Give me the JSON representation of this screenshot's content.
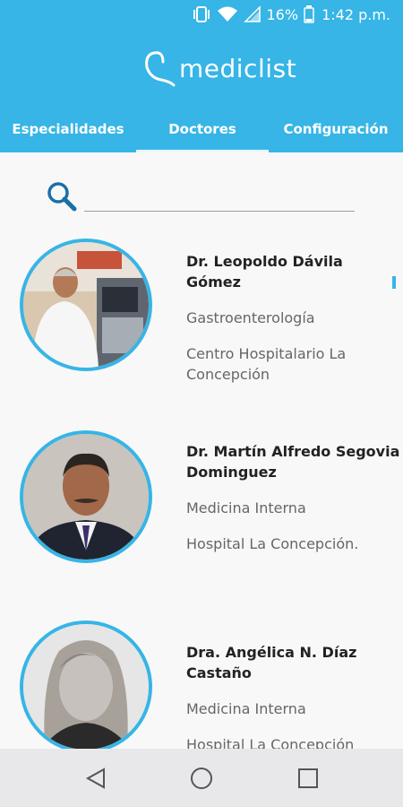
{
  "status_bar": {
    "battery_percent": "16%",
    "time": "1:42 p.m.",
    "icons": [
      "vibrate-icon",
      "wifi-icon",
      "signal-icon",
      "battery-icon"
    ]
  },
  "app": {
    "brand": "mediclist",
    "accent_color": "#36b5e6"
  },
  "tabs": [
    {
      "label": "Especialidades",
      "active": false
    },
    {
      "label": "Doctores",
      "active": true
    },
    {
      "label": "Configuración",
      "active": false
    }
  ],
  "search": {
    "value": "",
    "placeholder": ""
  },
  "doctors": [
    {
      "name": "Dr. Leopoldo Dávila Gómez",
      "specialty": "Gastroenterología",
      "hospital": "Centro Hospitalario La Concepción"
    },
    {
      "name": "Dr. Martín Alfredo Segovia Dominguez",
      "specialty": "Medicina Interna",
      "hospital": "Hospital La Concepción."
    },
    {
      "name": "Dra. Angélica N. Díaz Castaño",
      "specialty": "Medicina Interna",
      "hospital": "Hospital La Concepción"
    }
  ],
  "nav_bar": {
    "icons": [
      "back-icon",
      "home-icon",
      "recents-icon"
    ]
  }
}
